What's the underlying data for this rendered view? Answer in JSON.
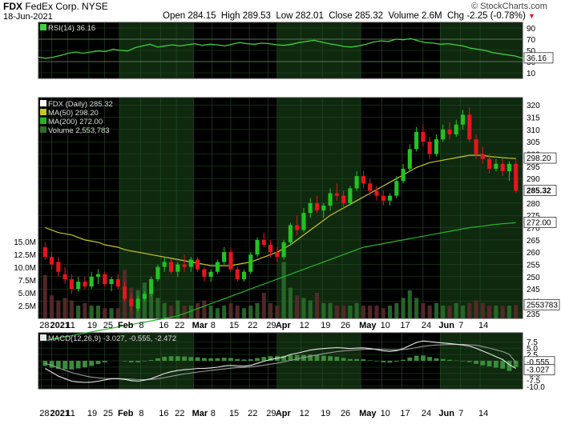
{
  "header": {
    "symbol": "FDX",
    "company": "FedEx Corp.",
    "exchange": "NYSE",
    "date": "18-Jun-2021",
    "open_label": "Open",
    "open": "284.15",
    "high_label": "High",
    "high": "289.53",
    "low_label": "Low",
    "low": "282.01",
    "close_label": "Close",
    "close": "285.32",
    "volume_label": "Volume",
    "volume": "2.6M",
    "chg_label": "Chg",
    "chg": "-2.25 (-0.78%)",
    "watermark": "© StockCharts.com"
  },
  "colors": {
    "up": "#22c322",
    "down": "#e8141e",
    "rsi": "#3cd23c",
    "ma50": "#c8c81e",
    "ma200": "#28b428",
    "bg": "#000000",
    "band": "#0f290f",
    "grid": "#285028"
  },
  "chart_data": [
    {
      "type": "line",
      "name": "rsi",
      "legend": "RSI(14) 36.16",
      "ylim": [
        0,
        100
      ],
      "ticks": [
        "90",
        "70",
        "50",
        "30",
        "10"
      ],
      "tick_values": [
        90,
        70,
        50,
        30,
        10
      ],
      "overbought": 70,
      "oversold": 30,
      "last_label": "36.16",
      "values": [
        38,
        36,
        38,
        41,
        45,
        47,
        45,
        47,
        49,
        48,
        52,
        50,
        49,
        55,
        58,
        61,
        56,
        58,
        60,
        58,
        60,
        62,
        59,
        61,
        60,
        58,
        61,
        64,
        62,
        61,
        63,
        62,
        60,
        59,
        61,
        64,
        66,
        68,
        65,
        62,
        60,
        57,
        56,
        58,
        61,
        65,
        67,
        66,
        70,
        69,
        71,
        67,
        64,
        63,
        61,
        62,
        60,
        58,
        54,
        52,
        50,
        46,
        44,
        42,
        40,
        36
      ]
    },
    {
      "type": "candlestick",
      "name": "price",
      "ylim": [
        233,
        323
      ],
      "ticks": [
        "320",
        "315",
        "310",
        "305",
        "300",
        "295",
        "290",
        "285",
        "280",
        "275",
        "270",
        "265",
        "260",
        "255",
        "250",
        "245",
        "240",
        "235"
      ],
      "tick_values": [
        320,
        315,
        310,
        305,
        300,
        295,
        290,
        285,
        280,
        275,
        270,
        265,
        260,
        255,
        250,
        245,
        240,
        235
      ],
      "legend": [
        "FDX (Daily) 285.32",
        "MA(50) 298.20",
        "MA(200) 272.00",
        "Volume 2,553,783"
      ],
      "last_labels": {
        "ma50": "298.20",
        "close": "285.32",
        "ma200": "272.00"
      },
      "volume_ticks": [
        "15.0M",
        "12.5M",
        "10.0M",
        "7.5M",
        "5.0M",
        "2.5M"
      ],
      "volume_tick_values": [
        15.0,
        12.5,
        10.0,
        7.5,
        5.0,
        2.5
      ],
      "volume_last_label": "2553783",
      "volume_ylim": [
        0,
        20
      ],
      "ohlc": [
        [
          262,
          264,
          257,
          258
        ],
        [
          258,
          260,
          253,
          255
        ],
        [
          256,
          258,
          250,
          252
        ],
        [
          251,
          254,
          247,
          249
        ],
        [
          249,
          251,
          243,
          245
        ],
        [
          245,
          250,
          244,
          248
        ],
        [
          248,
          250,
          245,
          246
        ],
        [
          246,
          252,
          245,
          250
        ],
        [
          250,
          253,
          247,
          251
        ],
        [
          251,
          252,
          246,
          247
        ],
        [
          247,
          250,
          244,
          249
        ],
        [
          249,
          251,
          245,
          246
        ],
        [
          246,
          248,
          240,
          241
        ],
        [
          241,
          243,
          236,
          238
        ],
        [
          237,
          242,
          236,
          241
        ],
        [
          241,
          244,
          240,
          243
        ],
        [
          243,
          250,
          242,
          249
        ],
        [
          249,
          255,
          248,
          254
        ],
        [
          254,
          258,
          252,
          256
        ],
        [
          256,
          257,
          251,
          252
        ],
        [
          252,
          256,
          250,
          255
        ],
        [
          255,
          259,
          252,
          254
        ],
        [
          254,
          258,
          252,
          257
        ],
        [
          257,
          258,
          252,
          253
        ],
        [
          253,
          254,
          248,
          250
        ],
        [
          250,
          253,
          248,
          252
        ],
        [
          252,
          257,
          251,
          256
        ],
        [
          256,
          262,
          255,
          260
        ],
        [
          260,
          262,
          252,
          253
        ],
        [
          253,
          254,
          248,
          249
        ],
        [
          249,
          253,
          248,
          252
        ],
        [
          252,
          260,
          251,
          259
        ],
        [
          259,
          266,
          258,
          265
        ],
        [
          265,
          268,
          262,
          263
        ],
        [
          263,
          265,
          258,
          260
        ],
        [
          260,
          262,
          256,
          258
        ],
        [
          258,
          265,
          257,
          264
        ],
        [
          264,
          272,
          263,
          271
        ],
        [
          271,
          275,
          267,
          269
        ],
        [
          269,
          278,
          268,
          276
        ],
        [
          276,
          282,
          274,
          280
        ],
        [
          280,
          283,
          276,
          277
        ],
        [
          277,
          280,
          274,
          279
        ],
        [
          279,
          286,
          277,
          284
        ],
        [
          284,
          288,
          281,
          283
        ],
        [
          283,
          285,
          278,
          280
        ],
        [
          280,
          287,
          279,
          286
        ],
        [
          286,
          293,
          285,
          291
        ],
        [
          291,
          293,
          286,
          288
        ],
        [
          288,
          290,
          283,
          285
        ],
        [
          285,
          287,
          281,
          283
        ],
        [
          283,
          285,
          279,
          281
        ],
        [
          281,
          284,
          279,
          283
        ],
        [
          283,
          291,
          282,
          289
        ],
        [
          289,
          296,
          288,
          294
        ],
        [
          294,
          304,
          293,
          302
        ],
        [
          302,
          311,
          301,
          309
        ],
        [
          309,
          312,
          303,
          305
        ],
        [
          305,
          307,
          298,
          300
        ],
        [
          300,
          308,
          299,
          306
        ],
        [
          306,
          312,
          305,
          310
        ],
        [
          310,
          313,
          306,
          308
        ],
        [
          308,
          314,
          307,
          312
        ],
        [
          312,
          318,
          310,
          316
        ],
        [
          316,
          319,
          305,
          306
        ],
        [
          306,
          308,
          298,
          300
        ],
        [
          300,
          303,
          296,
          298
        ],
        [
          298,
          300,
          292,
          294
        ],
        [
          294,
          298,
          293,
          296
        ],
        [
          296,
          298,
          291,
          293
        ],
        [
          293,
          297,
          289,
          296
        ],
        [
          296,
          298,
          284,
          285
        ]
      ],
      "ma50": [
        270,
        269,
        268,
        267.5,
        267,
        266,
        265,
        264.5,
        264,
        263,
        262.5,
        262,
        261,
        260.5,
        260,
        259.5,
        259,
        258.5,
        258,
        257.5,
        257,
        256.5,
        256,
        255.5,
        255,
        254.5,
        254.5,
        254.5,
        254.5,
        255,
        255.5,
        256,
        257,
        258,
        259,
        260,
        261.5,
        263,
        265,
        267,
        269,
        271,
        273,
        275,
        276.5,
        278,
        279.5,
        281,
        282.5,
        284,
        285.5,
        287,
        288.5,
        290,
        291.5,
        293,
        294.5,
        295.5,
        296.5,
        297,
        297.5,
        298,
        298.5,
        299,
        299.5,
        299.5,
        299.5,
        299,
        298.8,
        298.5,
        298.3,
        298.2
      ],
      "ma200": [
        224,
        224.5,
        225,
        225.5,
        226,
        226.5,
        227,
        227.5,
        228,
        228.5,
        229,
        229.5,
        230,
        230.5,
        231,
        231.5,
        232,
        232.5,
        233,
        233.5,
        234,
        235,
        236,
        237,
        238,
        239,
        240,
        241,
        242,
        243,
        244,
        245,
        246,
        247,
        248,
        249,
        250,
        251,
        252,
        253,
        254,
        255,
        256,
        257,
        258,
        259,
        260,
        261,
        262,
        262.5,
        263,
        263.5,
        264,
        264.5,
        265,
        265.5,
        266,
        266.5,
        267,
        267.5,
        268,
        268.5,
        269,
        269.5,
        270,
        270.3,
        270.6,
        271,
        271.3,
        271.6,
        271.8,
        272
      ],
      "volume": [
        8.5,
        4.5,
        3.5,
        4,
        3.5,
        2.5,
        3,
        2.5,
        2.5,
        2,
        2,
        2,
        9.5,
        6,
        5.5,
        7,
        5,
        4,
        3,
        2.5,
        3.5,
        2.5,
        2.5,
        3,
        3.5,
        2.5,
        2,
        2.5,
        3,
        2.5,
        2,
        2.5,
        3,
        5,
        3,
        2.5,
        11,
        6,
        4.5,
        4,
        3.5,
        5,
        3,
        3,
        2.5,
        2.5,
        2.5,
        3,
        2.5,
        2.5,
        2.5,
        2,
        2.5,
        3,
        4,
        5.5,
        4,
        3,
        2.5,
        3,
        2.5,
        2.5,
        3,
        2.5,
        3,
        3.5,
        3,
        2.5,
        2.5,
        2.5,
        2.5,
        2.6
      ]
    },
    {
      "type": "line",
      "name": "macd",
      "legend": "MACD(12,26,9) -3.027, -0.555, -2.472",
      "ylim": [
        -11,
        11
      ],
      "ticks": [
        "7.5",
        "5.0",
        "2.5",
        "0.0",
        "-2.5",
        "-5.0",
        "-7.5",
        "-10.0"
      ],
      "tick_values": [
        7.5,
        5,
        2.5,
        0,
        -2.5,
        -5,
        -7.5,
        -10
      ],
      "last_labels": {
        "signal": "-0.555",
        "macd": "-3.027"
      },
      "macd": [
        -3,
        -4.5,
        -6,
        -7,
        -8,
        -8.3,
        -8.5,
        -8.4,
        -8,
        -7.5,
        -7,
        -7,
        -7.3,
        -7.8,
        -8,
        -7.6,
        -7,
        -6,
        -5,
        -4.3,
        -3.8,
        -3.5,
        -3.3,
        -3,
        -3,
        -2.8,
        -2.5,
        -2,
        -1.8,
        -2,
        -2.1,
        -1.8,
        -1,
        -0.2,
        0.5,
        1,
        1.5,
        2.5,
        3,
        3.6,
        4.2,
        4.6,
        4.8,
        5,
        5.2,
        5,
        4.8,
        5,
        5.1,
        4.8,
        4.4,
        3.9,
        3.7,
        4,
        4.8,
        6,
        7.2,
        7.8,
        7.5,
        7.2,
        7,
        6.8,
        6.5,
        6.2,
        5.8,
        4.9,
        3.8,
        2.8,
        1.6,
        0.5,
        -1.5,
        -3.0
      ],
      "signal": [
        -1,
        -1.8,
        -2.8,
        -3.7,
        -4.6,
        -5.3,
        -5.9,
        -6.4,
        -6.7,
        -6.9,
        -7,
        -7,
        -7.1,
        -7.2,
        -7.4,
        -7.4,
        -7.3,
        -7,
        -6.6,
        -6.1,
        -5.6,
        -5.2,
        -4.8,
        -4.4,
        -4.1,
        -3.8,
        -3.5,
        -3.2,
        -2.9,
        -2.7,
        -2.6,
        -2.4,
        -2.1,
        -1.7,
        -1.3,
        -0.9,
        -0.4,
        0.2,
        0.7,
        1.3,
        1.8,
        2.3,
        2.8,
        3.2,
        3.6,
        3.9,
        4.1,
        4.3,
        4.5,
        4.6,
        4.6,
        4.5,
        4.4,
        4.3,
        4.4,
        4.7,
        5.2,
        5.7,
        6,
        6.2,
        6.3,
        6.4,
        6.4,
        6.4,
        6.3,
        6.1,
        5.6,
        5,
        4.3,
        3.6,
        2.5,
        -0.555
      ]
    }
  ],
  "x_axis": {
    "labels": [
      "28",
      "2021",
      "11",
      "19",
      "25",
      "Feb",
      "8",
      "16",
      "22",
      "Mar",
      "8",
      "15",
      "22",
      "29",
      "Apr",
      "12",
      "19",
      "26",
      "May",
      "10",
      "17",
      "24",
      "Jun",
      "7",
      "14"
    ],
    "bold": [
      "2021",
      "Feb",
      "Mar",
      "Apr",
      "May",
      "Jun"
    ]
  }
}
